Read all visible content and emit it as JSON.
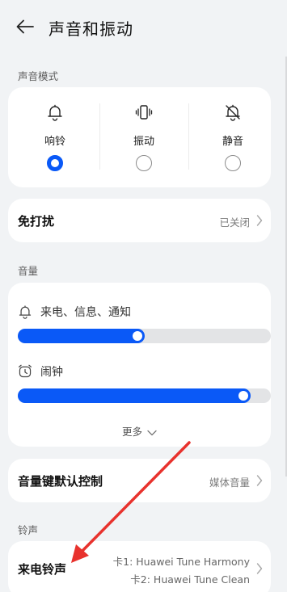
{
  "header": {
    "title": "声音和振动"
  },
  "sound_mode": {
    "section_label": "声音模式",
    "options": [
      {
        "label": "响铃",
        "icon": "bell-icon",
        "selected": true
      },
      {
        "label": "振动",
        "icon": "vibrate-icon",
        "selected": false
      },
      {
        "label": "静音",
        "icon": "bell-off-icon",
        "selected": false
      }
    ],
    "accent_color": "#0a59f7"
  },
  "dnd": {
    "label": "免打扰",
    "value": "已关闭"
  },
  "volume": {
    "section_label": "音量",
    "sliders": [
      {
        "label": "来电、信息、通知",
        "icon": "bell-icon",
        "level": 0.5
      },
      {
        "label": "闹钟",
        "icon": "alarm-clock-icon",
        "level": 0.92
      }
    ],
    "more_label": "更多"
  },
  "volume_key": {
    "label": "音量键默认控制",
    "value": "媒体音量"
  },
  "ringtone": {
    "section_label": "铃声",
    "label": "来电铃声",
    "card1": "卡1: Huawei Tune Harmony",
    "card2": "卡2: Huawei Tune Clean"
  },
  "annotation": {
    "color": "#e8322d"
  }
}
